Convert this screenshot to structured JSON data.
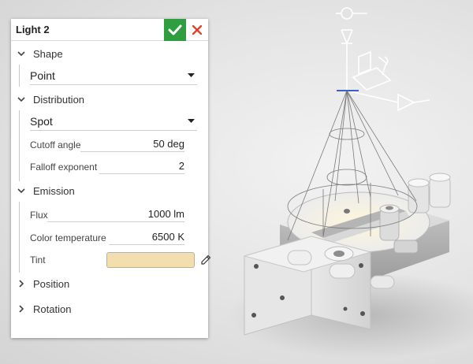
{
  "panel": {
    "title": "Light 2",
    "sections": {
      "shape": {
        "label": "Shape",
        "value": "Point"
      },
      "distribution": {
        "label": "Distribution",
        "value": "Spot",
        "cutoff_angle": {
          "label": "Cutoff angle",
          "value": "50 deg"
        },
        "falloff_exponent": {
          "label": "Falloff exponent",
          "value": "2"
        }
      },
      "emission": {
        "label": "Emission",
        "flux": {
          "label": "Flux",
          "value": "1000 lm"
        },
        "color_temperature": {
          "label": "Color temperature",
          "value": "6500 K"
        },
        "tint": {
          "label": "Tint",
          "color": "#f3dfae"
        }
      },
      "position": {
        "label": "Position"
      },
      "rotation": {
        "label": "Rotation"
      }
    }
  },
  "colors": {
    "accept": "#2e9e3e",
    "close": "#d9472b",
    "axis_blue": "#3a5fcd"
  },
  "icons": [
    "check-icon",
    "close-icon",
    "chevron-down-icon",
    "chevron-right-icon",
    "caret-down-icon",
    "pencil-icon",
    "light-gizmo-icon"
  ]
}
